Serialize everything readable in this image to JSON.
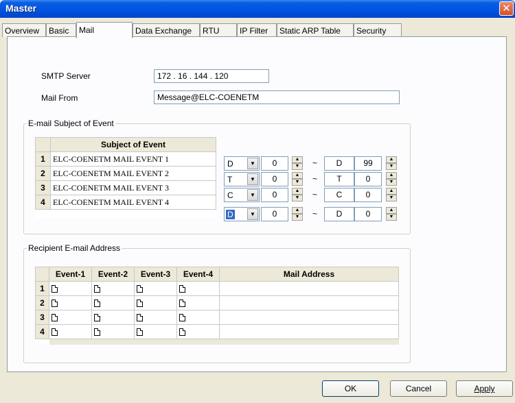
{
  "window": {
    "title": "Master",
    "close_glyph": "✕"
  },
  "tabs": [
    "Overview",
    "Basic",
    "Mail",
    "Data Exchange",
    "RTU",
    "IP Filter",
    "Static ARP Table",
    "Security"
  ],
  "smtp": {
    "label": "SMTP Server",
    "value": "172 .  16  . 144 . 120"
  },
  "mail_from": {
    "label": "Mail From",
    "value": "Message@ELC-COENETM"
  },
  "subject_group": {
    "title": "E-mail Subject of Event",
    "header": "Subject of Event",
    "rows": [
      {
        "num": "1",
        "subject": "ELC-COENETM MAIL EVENT 1",
        "from_dev": "D",
        "from_val": "0",
        "to_dev": "D",
        "to_val": "99"
      },
      {
        "num": "2",
        "subject": "ELC-COENETM MAIL EVENT 2",
        "from_dev": "T",
        "from_val": "0",
        "to_dev": "T",
        "to_val": "0"
      },
      {
        "num": "3",
        "subject": "ELC-COENETM MAIL EVENT 3",
        "from_dev": "C",
        "from_val": "0",
        "to_dev": "C",
        "to_val": "0"
      },
      {
        "num": "4",
        "subject": "ELC-COENETM MAIL EVENT 4",
        "from_dev": "D",
        "from_val": "0",
        "to_dev": "D",
        "to_val": "0"
      }
    ],
    "tilde": "~"
  },
  "recipient_group": {
    "title": "Recipient E-mail Address",
    "headers": [
      "Event-1",
      "Event-2",
      "Event-3",
      "Event-4",
      "Mail Address"
    ],
    "rows": [
      "1",
      "2",
      "3",
      "4"
    ]
  },
  "buttons": {
    "ok": "OK",
    "cancel": "Cancel",
    "apply": "Apply"
  }
}
